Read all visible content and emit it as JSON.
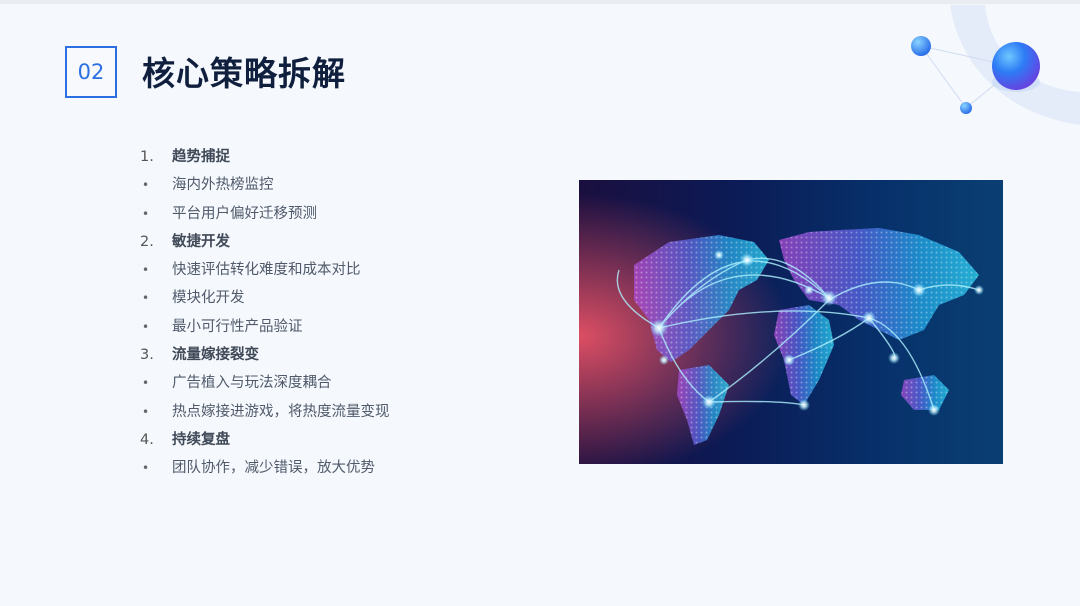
{
  "header": {
    "number": "02",
    "title": "核心策略拆解"
  },
  "sections": [
    {
      "marker": "1.",
      "label": "趋势捕捉",
      "items": [
        "海内外热榜监控",
        "平台用户偏好迁移预测"
      ]
    },
    {
      "marker": "2.",
      "label": " 敏捷开发",
      "items": [
        "快速评估转化难度和成本对比",
        "模块化开发",
        "最小可行性产品验证"
      ]
    },
    {
      "marker": "3.",
      "label": " 流量嫁接裂变",
      "items": [
        "广告植入与玩法深度耦合",
        "热点嫁接进游戏，将热度流量变现"
      ]
    },
    {
      "marker": "4.",
      "label": " 持续复盘",
      "items": [
        "团队协作，减少错误，放大优势"
      ]
    }
  ],
  "bullet_char": "•",
  "image": {
    "name": "world-network-map"
  },
  "colors": {
    "accent": "#2b6fe0",
    "title": "#0f1f3d",
    "background": "#f5f8fd"
  }
}
